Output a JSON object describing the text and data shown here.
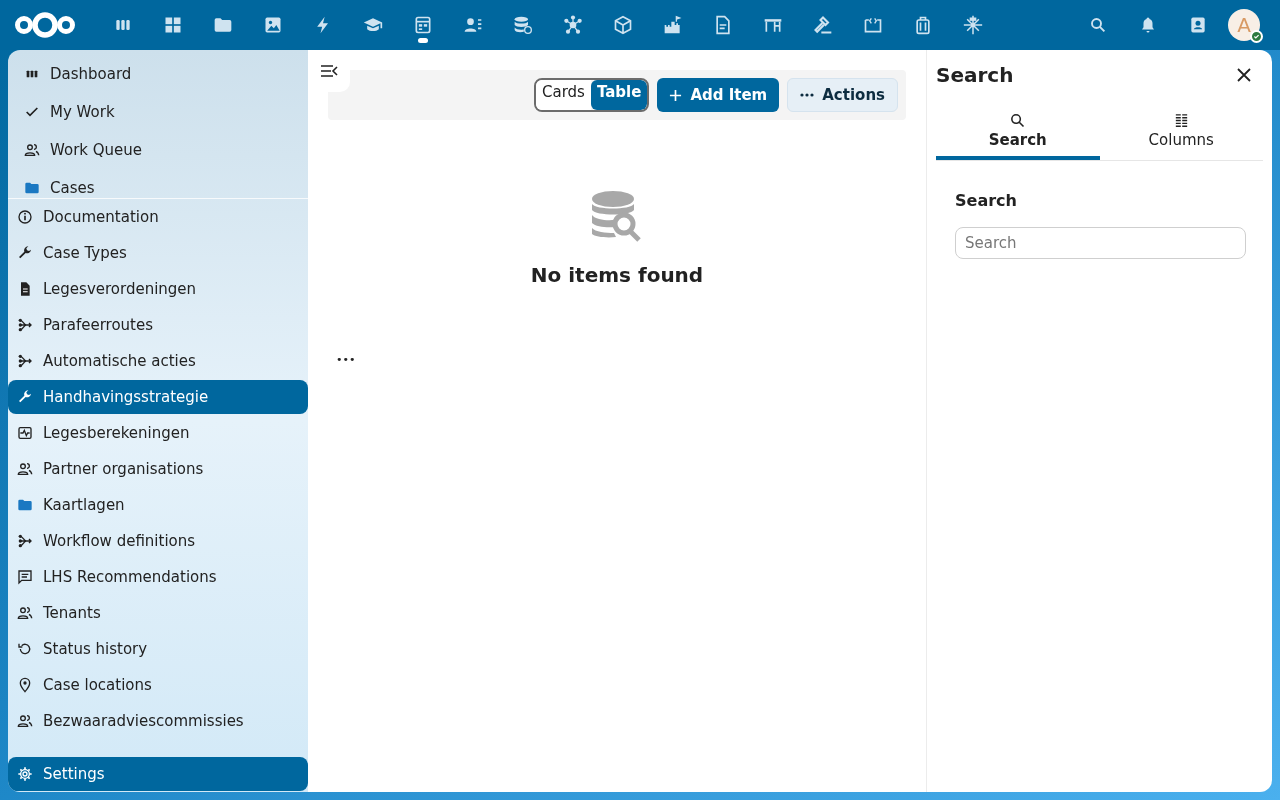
{
  "top_bar": {
    "apps": [
      {
        "selected": false
      },
      {
        "selected": false
      },
      {
        "selected": false
      },
      {
        "selected": false
      },
      {
        "selected": false
      },
      {
        "selected": false
      },
      {
        "selected": true
      },
      {
        "selected": false
      },
      {
        "selected": false
      },
      {
        "selected": false
      },
      {
        "selected": false
      },
      {
        "selected": false
      },
      {
        "selected": false
      },
      {
        "selected": false
      },
      {
        "selected": false
      },
      {
        "selected": false
      },
      {
        "selected": false
      },
      {
        "selected": false
      }
    ],
    "avatar": {
      "initial": "A",
      "online": true
    }
  },
  "sidebar": {
    "top_items": [
      {
        "label": "Dashboard",
        "selected": false
      },
      {
        "label": "My Work",
        "selected": false
      },
      {
        "label": "Work Queue",
        "selected": false
      },
      {
        "label": "Cases",
        "selected": false
      }
    ],
    "items": [
      {
        "label": "Documentation",
        "selected": false
      },
      {
        "label": "Case Types",
        "selected": false
      },
      {
        "label": "Legesverordeningen",
        "selected": false
      },
      {
        "label": "Parafeerroutes",
        "selected": false
      },
      {
        "label": "Automatische acties",
        "selected": false
      },
      {
        "label": "Handhavingsstrategie",
        "selected": true
      },
      {
        "label": "Legesberekeningen",
        "selected": false
      },
      {
        "label": "Partner organisations",
        "selected": false
      },
      {
        "label": "Kaartlagen",
        "selected": false
      },
      {
        "label": "Workflow definitions",
        "selected": false
      },
      {
        "label": "LHS Recommendations",
        "selected": false
      },
      {
        "label": "Tenants",
        "selected": false
      },
      {
        "label": "Status history",
        "selected": false
      },
      {
        "label": "Case locations",
        "selected": false
      },
      {
        "label": "Bezwaaradviescommissies",
        "selected": false
      }
    ],
    "settings": {
      "label": "Settings",
      "selected": true
    }
  },
  "toolbar": {
    "view_toggle": [
      {
        "label": "Cards",
        "selected": false
      },
      {
        "label": "Table",
        "selected": true
      }
    ],
    "add_button": "Add Item",
    "actions_button": "Actions"
  },
  "empty_state": {
    "message": "No items found"
  },
  "more_button": "•••",
  "search_panel": {
    "title": "Search",
    "tabs": [
      {
        "label": "Search",
        "selected": true
      },
      {
        "label": "Columns",
        "selected": false
      }
    ],
    "section_label": "Search",
    "search_field": {
      "placeholder": "Search"
    }
  }
}
